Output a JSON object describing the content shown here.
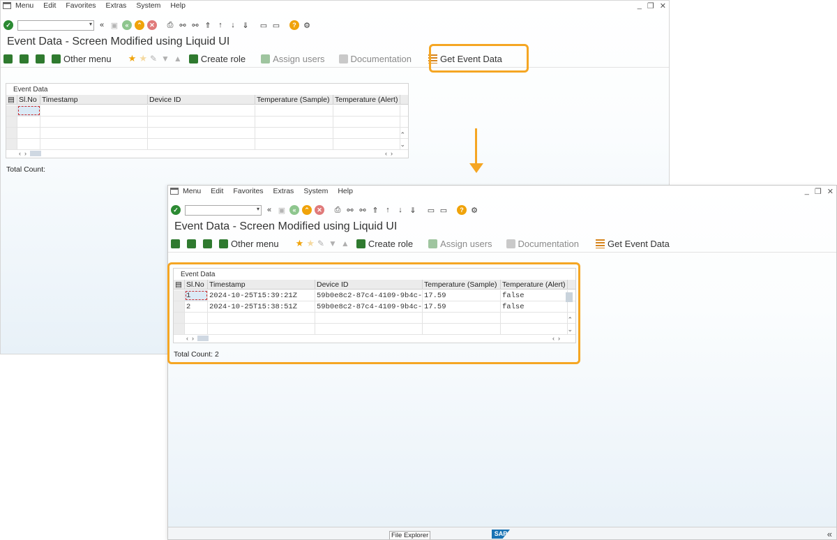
{
  "menu": [
    "Menu",
    "Edit",
    "Favorites",
    "Extras",
    "System",
    "Help"
  ],
  "window_controls": [
    "_",
    "❐",
    "✕"
  ],
  "screen_title": "Event Data  - Screen Modified using Liquid UI",
  "app_toolbar": {
    "other_menu": "Other menu",
    "create_role": "Create role",
    "assign_users": "Assign users",
    "documentation": "Documentation",
    "get_event_data": "Get Event Data"
  },
  "table": {
    "group_label": "Event Data",
    "columns": [
      "Sl.No",
      "Timestamp",
      "Device ID",
      "Temperature (Sample)",
      "Temperature (Alert)"
    ]
  },
  "before": {
    "rows": [],
    "total_count_label": "Total Count:"
  },
  "after": {
    "rows": [
      [
        "1",
        "2024-10-25T15:39:21Z",
        "59b0e8c2-87c4-4109-9b4c-b",
        "17.59",
        "false"
      ],
      [
        "2",
        "2024-10-25T15:38:51Z",
        "59b0e8c2-87c4-4109-9b4c-b",
        "17.59",
        "false"
      ]
    ],
    "total_count_label": "Total Count: 2"
  },
  "statusbar": {
    "file_explorer": "File Explorer",
    "sap_logo": "SAP"
  },
  "accent_color": "#f5a623"
}
